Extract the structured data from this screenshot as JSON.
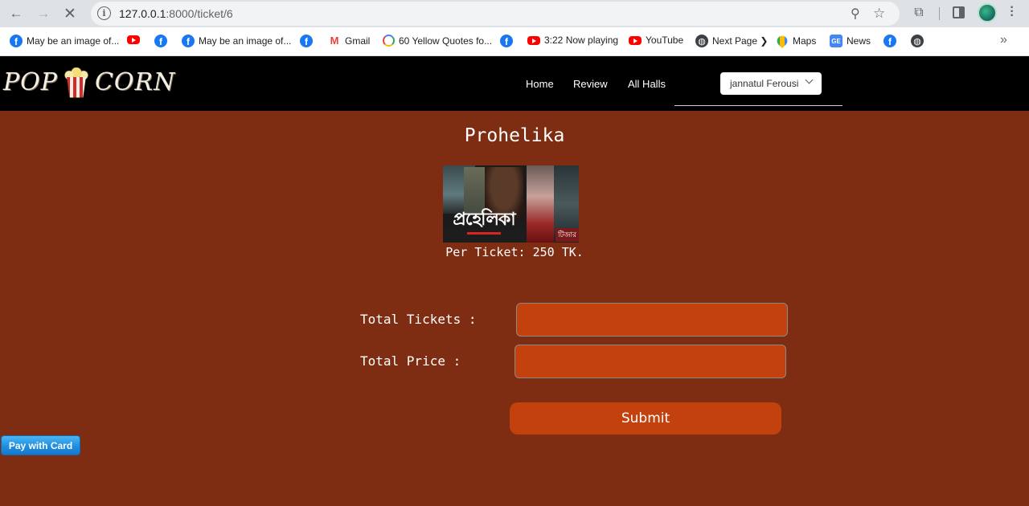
{
  "browser": {
    "url_host": "127.0.0.1",
    "url_path": ":8000/ticket/6",
    "bookmarks": [
      {
        "label": "May be an image of...",
        "icon": "facebook-icon"
      },
      {
        "label": "",
        "icon": "youtube-icon"
      },
      {
        "label": "",
        "icon": "facebook-icon"
      },
      {
        "label": "May be an image of...",
        "icon": "facebook-icon"
      },
      {
        "label": "",
        "icon": "facebook-icon"
      },
      {
        "label": "Gmail",
        "icon": "gmail-icon"
      },
      {
        "label": "60 Yellow Quotes fo...",
        "icon": "google-icon"
      },
      {
        "label": "",
        "icon": "facebook-icon"
      },
      {
        "label": "3:22 Now playing",
        "icon": "youtube-icon"
      },
      {
        "label": "YouTube",
        "icon": "youtube-icon"
      },
      {
        "label": "Next Page ❯",
        "icon": "globe-icon"
      },
      {
        "label": "Maps",
        "icon": "maps-icon"
      },
      {
        "label": "News",
        "icon": "news-icon"
      },
      {
        "label": "",
        "icon": "facebook-icon"
      },
      {
        "label": "",
        "icon": "globe-icon"
      }
    ]
  },
  "site": {
    "logo_left": "POP",
    "logo_right": "CORN",
    "nav": {
      "home": "Home",
      "review": "Review",
      "halls": "All Halls"
    },
    "user": "jannatul Ferousi"
  },
  "movie": {
    "title": "Prohelika",
    "poster_text": "প্রহেলিকা",
    "poster_tag": "টিজার",
    "per_ticket": "Per Ticket: 250 TK."
  },
  "form": {
    "total_tickets_label": "Total Tickets :",
    "total_tickets_value": "",
    "total_price_label": "Total Price :",
    "total_price_value": "",
    "submit_label": "Submit"
  },
  "payment": {
    "pay_label": "Pay with Card"
  },
  "colors": {
    "page_bg": "#7f2d12",
    "accent": "#c2410c",
    "nav_bg": "#000000",
    "pay_button": "#1f8ee0"
  }
}
